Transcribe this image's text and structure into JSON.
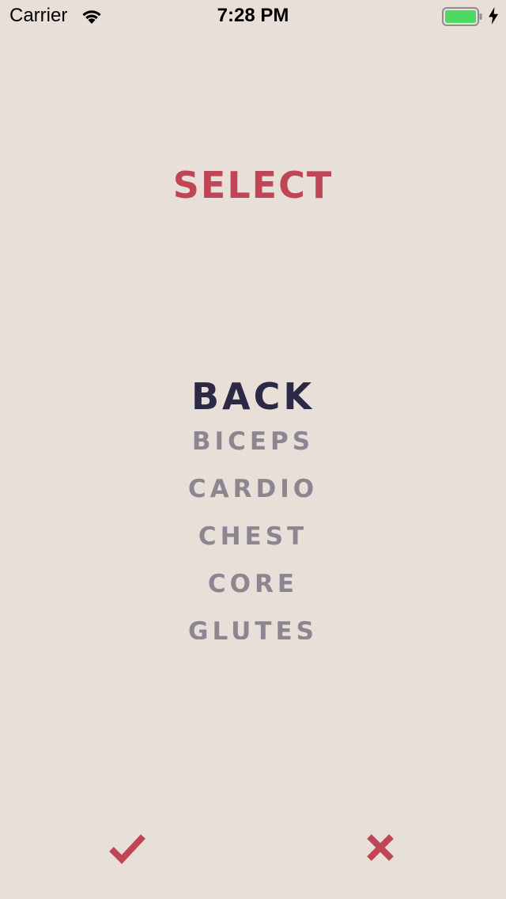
{
  "status_bar": {
    "carrier": "Carrier",
    "time": "7:28 PM",
    "battery_color": "#4cd964"
  },
  "header": {
    "title": "SELECT"
  },
  "picker": {
    "selected_index": 0,
    "items": [
      "BACK",
      "BICEPS",
      "CARDIO",
      "CHEST",
      "CORE",
      "GLUTES"
    ]
  },
  "actions": {
    "confirm_icon": "checkmark-icon",
    "cancel_icon": "close-icon"
  },
  "colors": {
    "background": "#e8dfd9",
    "accent": "#c04657",
    "selected_text": "#2c2944",
    "unselected_text": "#8b8690"
  }
}
